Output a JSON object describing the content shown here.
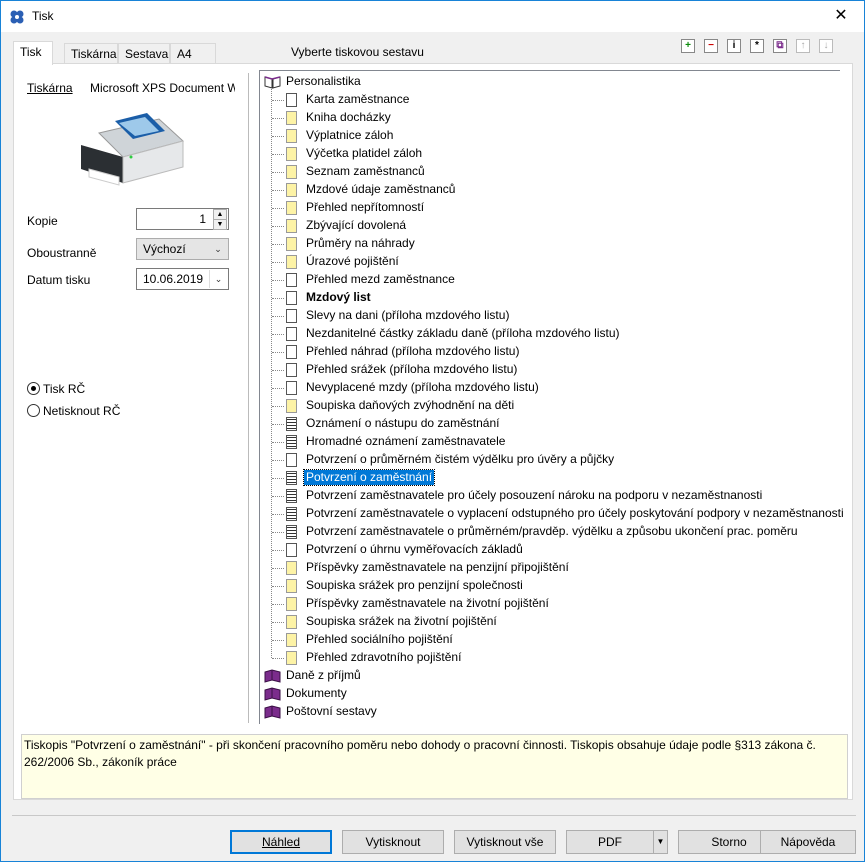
{
  "window": {
    "title": "Tisk",
    "close_glyph": "✕"
  },
  "tabs": [
    "Tisk",
    "Tiskárna",
    "Sestava",
    "A4"
  ],
  "prompt": "Vyberte tiskovou sestavu",
  "toolbar": [
    "plus-icon",
    "minus-icon",
    "info-icon",
    "edit-icon",
    "copy-icon",
    "arrow-up-icon",
    "arrow-down-icon"
  ],
  "left": {
    "printer_label": "Tiskárna",
    "printer_name": "Microsoft XPS Document W",
    "copies_label": "Kopie",
    "copies_value": "1",
    "duplex_label": "Oboustranně",
    "duplex_value": "Výchozí",
    "date_label": "Datum tisku",
    "date_value": "10.06.2019",
    "radio1": "Tisk RČ",
    "radio2": "Netisknout RČ"
  },
  "tree": {
    "root": "Personalistika",
    "items": [
      {
        "label": "Karta zaměstnance",
        "icon": "doc"
      },
      {
        "label": "Kniha docházky",
        "icon": "yellow"
      },
      {
        "label": "Výplatnice záloh",
        "icon": "yellow"
      },
      {
        "label": "Výčetka platidel záloh",
        "icon": "yellow"
      },
      {
        "label": "Seznam zaměstnanců",
        "icon": "yellow"
      },
      {
        "label": "Mzdové údaje zaměstnanců",
        "icon": "yellow"
      },
      {
        "label": "Přehled nepřítomností",
        "icon": "yellow"
      },
      {
        "label": "Zbývající dovolená",
        "icon": "yellow"
      },
      {
        "label": "Průměry na náhrady",
        "icon": "yellow"
      },
      {
        "label": "Úrazové pojištění",
        "icon": "yellow"
      },
      {
        "label": "Přehled mezd zaměstnance",
        "icon": "doc"
      },
      {
        "label": "Mzdový list",
        "icon": "doc",
        "bold": true
      },
      {
        "label": "Slevy na dani (příloha mzdového listu)",
        "icon": "doc"
      },
      {
        "label": "Nezdanitelné částky základu daně (příloha mzdového listu)",
        "icon": "doc"
      },
      {
        "label": "Přehled náhrad (příloha mzdového listu)",
        "icon": "doc"
      },
      {
        "label": "Přehled srážek (příloha mzdového listu)",
        "icon": "doc"
      },
      {
        "label": "Nevyplacené mzdy (příloha mzdového listu)",
        "icon": "doc"
      },
      {
        "label": "Soupiska daňových zvýhodnění na děti",
        "icon": "yellow"
      },
      {
        "label": "Oznámení o nástupu do zaměstnání",
        "icon": "lines"
      },
      {
        "label": "Hromadné oznámení zaměstnavatele",
        "icon": "lines"
      },
      {
        "label": "Potvrzení o průměrném čistém výdělku pro úvěry a půjčky",
        "icon": "doc"
      },
      {
        "label": "Potvrzení o zaměstnání",
        "icon": "lines",
        "selected": true
      },
      {
        "label": "Potvrzení zaměstnavatele pro účely posouzení nároku na podporu v nezaměstnanosti",
        "icon": "lines"
      },
      {
        "label": "Potvrzení zaměstnavatele o vyplacení odstupného pro účely poskytování podpory v nezaměstnanosti",
        "icon": "lines"
      },
      {
        "label": "Potvrzení zaměstnavatele o průměrném/pravděp. výdělku a způsobu ukončení prac. poměru",
        "icon": "lines"
      },
      {
        "label": "Potvrzení o úhrnu vyměřovacích základů",
        "icon": "doc"
      },
      {
        "label": "Příspěvky zaměstnavatele na penzijní připojištění",
        "icon": "yellow"
      },
      {
        "label": "Soupiska srážek pro penzijní společnosti",
        "icon": "yellow"
      },
      {
        "label": "Příspěvky zaměstnavatele na životní pojištění",
        "icon": "yellow"
      },
      {
        "label": "Soupiska srážek na životní pojištění",
        "icon": "yellow"
      },
      {
        "label": "Přehled sociálního pojištění",
        "icon": "yellow"
      },
      {
        "label": "Přehled zdravotního pojištění",
        "icon": "yellow"
      }
    ],
    "groups": [
      "Daně z příjmů",
      "Dokumenty",
      "Poštovní sestavy"
    ]
  },
  "info_text": "Tiskopis \"Potvrzení o zaměstnání\" - při skončení pracovního poměru nebo dohody o pracovní činnosti. Tiskopis obsahuje údaje podle §313 zákona č. 262/2006 Sb., zákoník práce",
  "buttons": {
    "preview": "Náhled",
    "print": "Vytisknout",
    "print_all": "Vytisknout vše",
    "pdf": "PDF",
    "cancel": "Storno",
    "help": "Nápověda"
  },
  "colors": {
    "selection": "#0078d7",
    "info_bg": "#ffffe6",
    "book": "#7b2c8c"
  }
}
